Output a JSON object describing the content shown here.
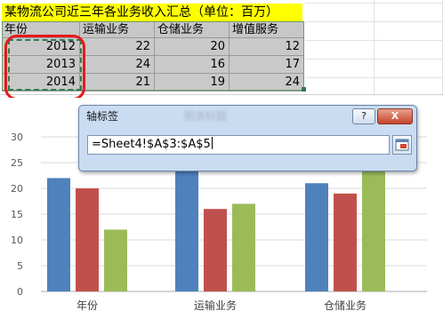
{
  "sheet": {
    "title": "某物流公司近三年各业务收入汇总（单位：百万）",
    "headers": [
      "年份",
      "运输业务",
      "仓储业务",
      "增值服务"
    ],
    "rows": [
      [
        "2012",
        "22",
        "20",
        "12"
      ],
      [
        "2013",
        "24",
        "16",
        "17"
      ],
      [
        "2014",
        "21",
        "19",
        "24"
      ]
    ]
  },
  "dialog": {
    "title": "轴标签",
    "faded_title": "图表标题",
    "help_label": "?",
    "close_label": "X",
    "formula": "=Sheet4!$A$3:$A$5"
  },
  "chart_data": {
    "type": "bar",
    "categories": [
      "年份",
      "运输业务",
      "仓储业务"
    ],
    "series": [
      {
        "values": [
          22,
          24,
          21
        ]
      },
      {
        "values": [
          20,
          16,
          19
        ]
      },
      {
        "values": [
          12,
          17,
          24
        ]
      }
    ],
    "series_colors": [
      "#4f81bd",
      "#c0504d",
      "#9bbb59"
    ],
    "y_ticks": [
      "0",
      "5",
      "10",
      "15",
      "20",
      "25",
      "30"
    ],
    "ylim": [
      0,
      30
    ],
    "grid": true
  }
}
